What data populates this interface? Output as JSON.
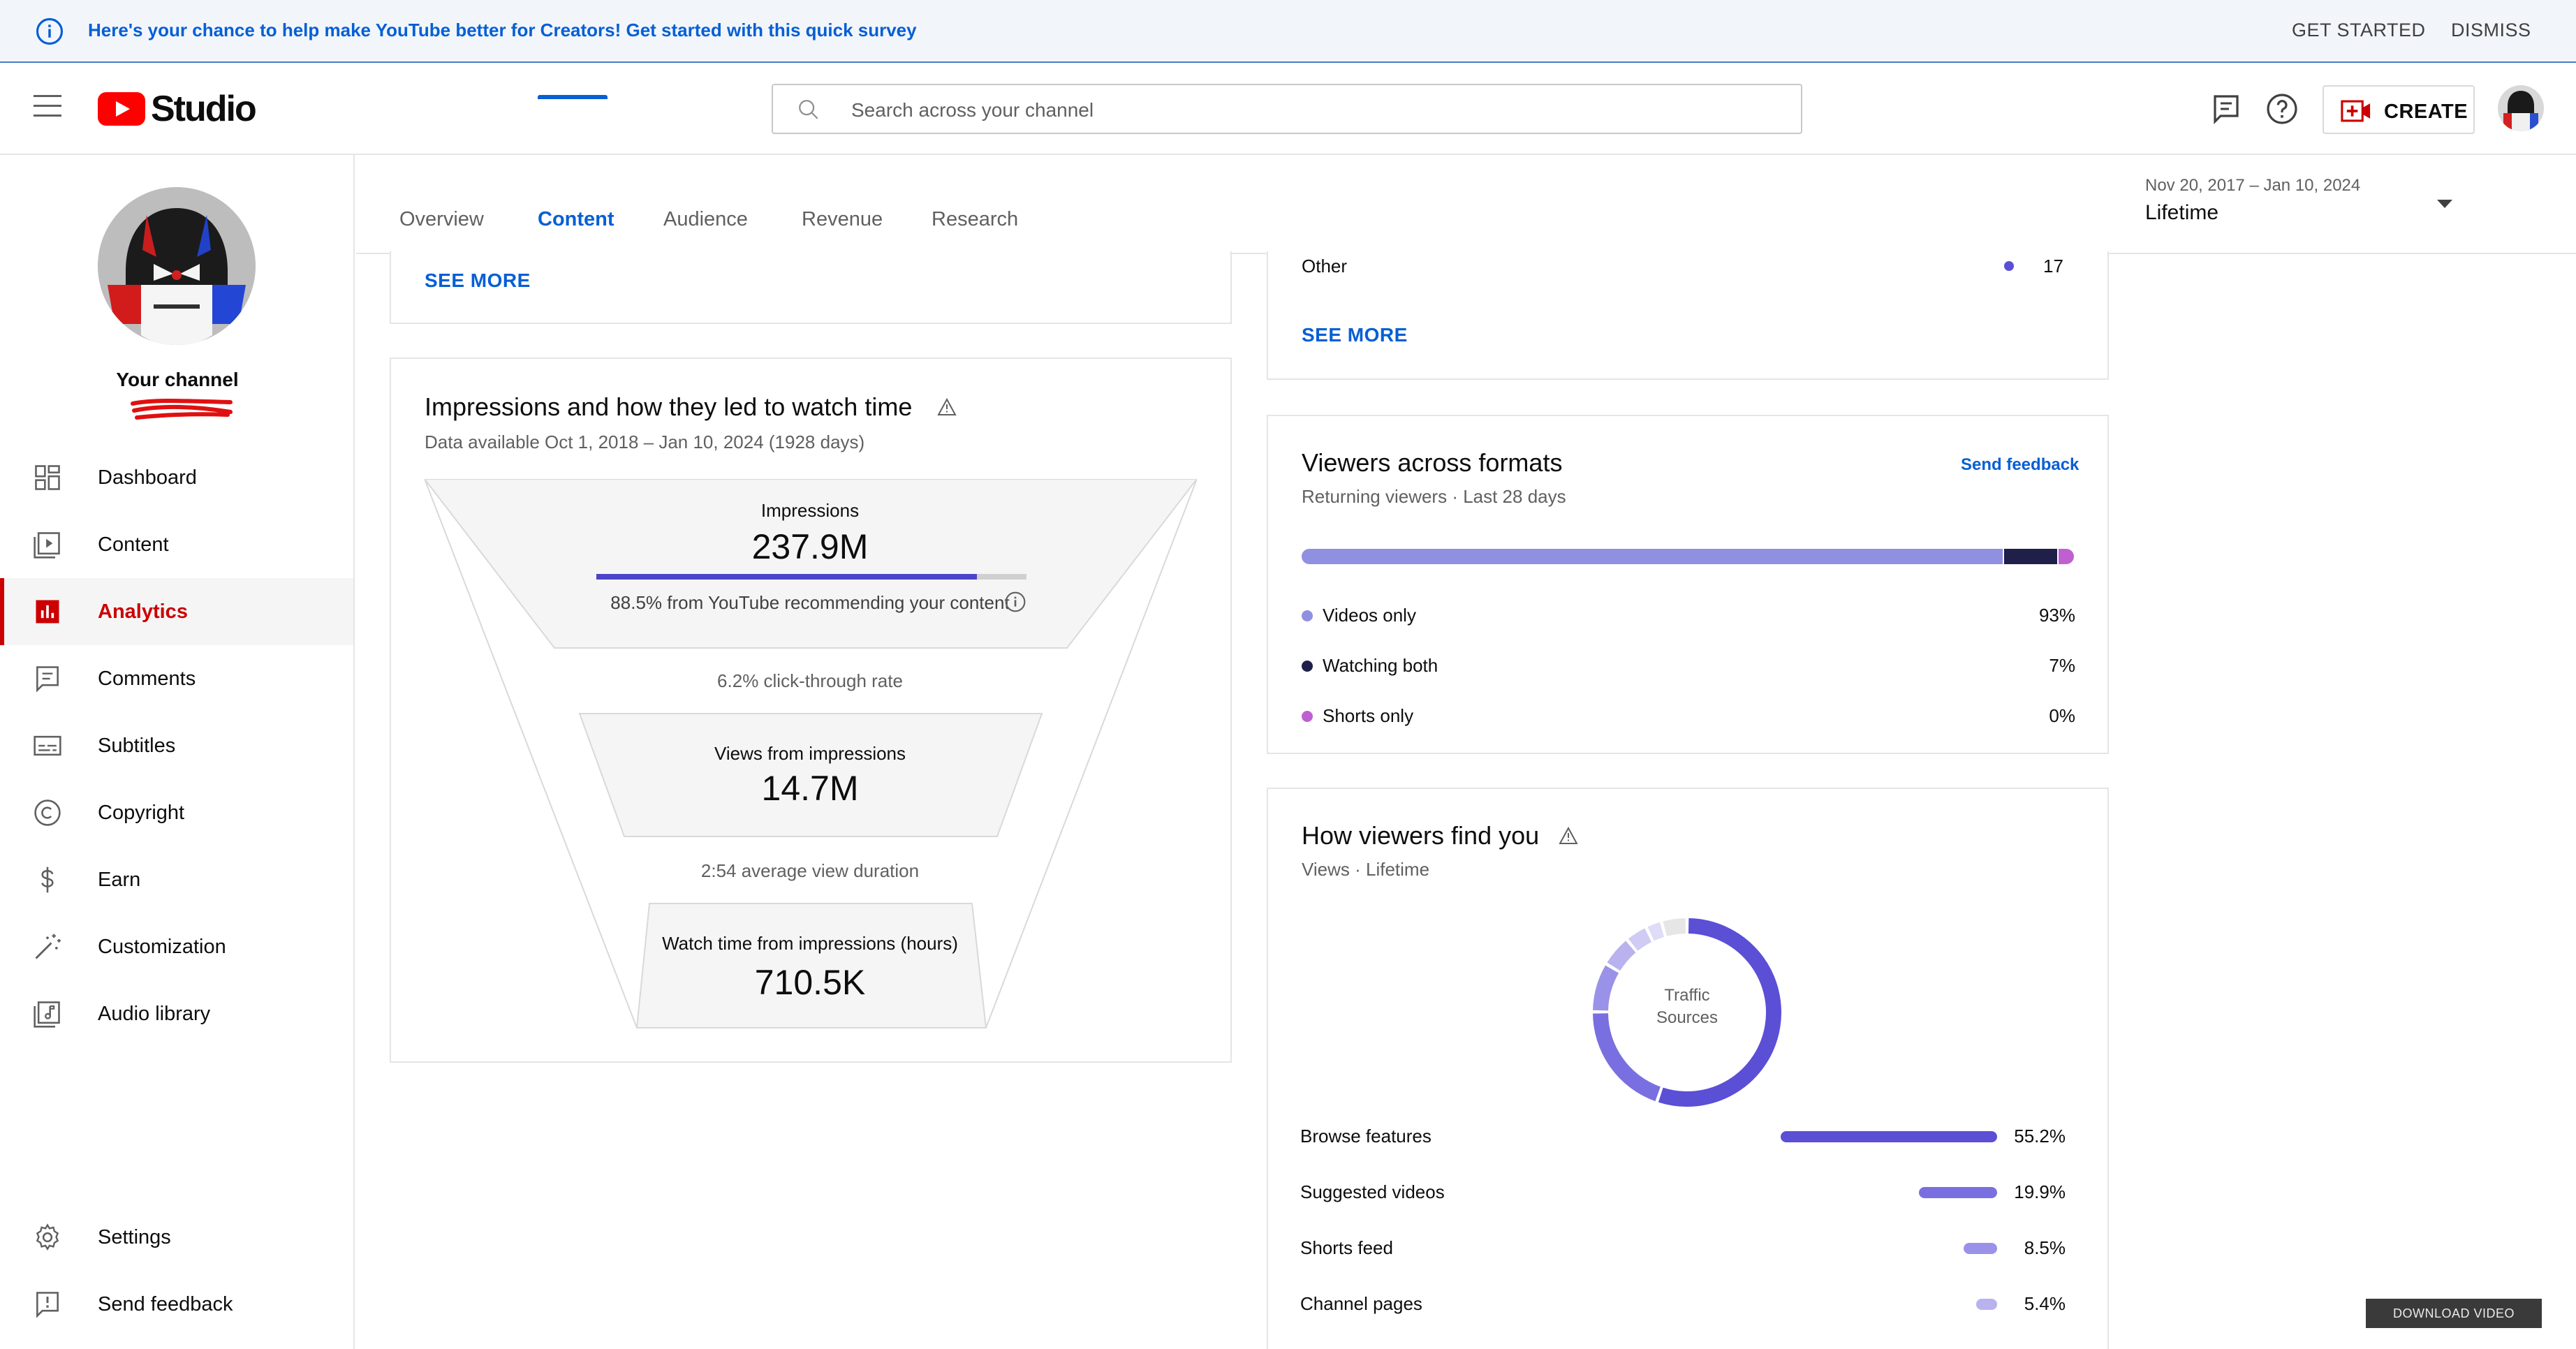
{
  "banner": {
    "message": "Here's your chance to help make YouTube better for Creators! Get started with this quick survey",
    "get_started": "GET STARTED",
    "dismiss": "DISMISS"
  },
  "header": {
    "logo_text": "Studio",
    "search_placeholder": "Search across your channel",
    "create_label": "CREATE"
  },
  "sidebar": {
    "channel_label": "Your channel",
    "items": [
      {
        "label": "Dashboard",
        "icon": "dashboard-icon"
      },
      {
        "label": "Content",
        "icon": "content-icon"
      },
      {
        "label": "Analytics",
        "icon": "analytics-icon",
        "active": true
      },
      {
        "label": "Comments",
        "icon": "comments-icon"
      },
      {
        "label": "Subtitles",
        "icon": "subtitles-icon"
      },
      {
        "label": "Copyright",
        "icon": "copyright-icon"
      },
      {
        "label": "Earn",
        "icon": "dollar-icon"
      },
      {
        "label": "Customization",
        "icon": "magic-wand-icon"
      },
      {
        "label": "Audio library",
        "icon": "audio-library-icon"
      }
    ],
    "bottom_items": [
      {
        "label": "Settings",
        "icon": "gear-icon"
      },
      {
        "label": "Send feedback",
        "icon": "feedback-icon"
      }
    ]
  },
  "tabs": {
    "items": [
      "Overview",
      "Content",
      "Audience",
      "Revenue",
      "Research"
    ],
    "active": "Content",
    "date_range": "Nov 20, 2017 – Jan 10, 2024",
    "date_preset": "Lifetime"
  },
  "top_left_card": {
    "see_more": "SEE MORE"
  },
  "top_right_card": {
    "row_label": "Other",
    "row_value": "17",
    "see_more": "SEE MORE"
  },
  "impressions": {
    "title": "Impressions and how they led to watch time",
    "subtitle": "Data available Oct 1, 2018 – Jan 10, 2024 (1928 days)",
    "impressions_label": "Impressions",
    "impressions_value": "237.9M",
    "recommend_fraction": 0.885,
    "recommend_text": "88.5% from YouTube recommending your content",
    "ctr_text": "6.2% click-through rate",
    "views_label": "Views from impressions",
    "views_value": "14.7M",
    "avd_text": "2:54 average view duration",
    "watch_label": "Watch time from impressions (hours)",
    "watch_value": "710.5K"
  },
  "formats": {
    "title": "Viewers across formats",
    "subtitle": "Returning viewers · Last 28 days",
    "send_feedback": "Send feedback",
    "colors": {
      "videos": "#9090e0",
      "both": "#1f1f4a",
      "shorts": "#c060d0"
    },
    "rows": [
      {
        "name": "Videos only",
        "value": "93%",
        "fraction": 0.93
      },
      {
        "name": "Watching both",
        "value": "7%",
        "fraction": 0.07
      },
      {
        "name": "Shorts only",
        "value": "0%",
        "fraction": 0.0
      }
    ]
  },
  "traffic": {
    "title": "How viewers find you",
    "subtitle": "Views · Lifetime",
    "donut_label_1": "Traffic",
    "donut_label_2": "Sources",
    "rows": [
      {
        "name": "Browse features",
        "value": "55.2%",
        "fraction": 0.552,
        "color": "#5b4fd6"
      },
      {
        "name": "Suggested videos",
        "value": "19.9%",
        "fraction": 0.199,
        "color": "#7a6fe0"
      },
      {
        "name": "Shorts feed",
        "value": "8.5%",
        "fraction": 0.085,
        "color": "#9a92e8"
      },
      {
        "name": "Channel pages",
        "value": "5.4%",
        "fraction": 0.054,
        "color": "#b8b2ef"
      }
    ]
  },
  "download_label": "DOWNLOAD VIDEO"
}
